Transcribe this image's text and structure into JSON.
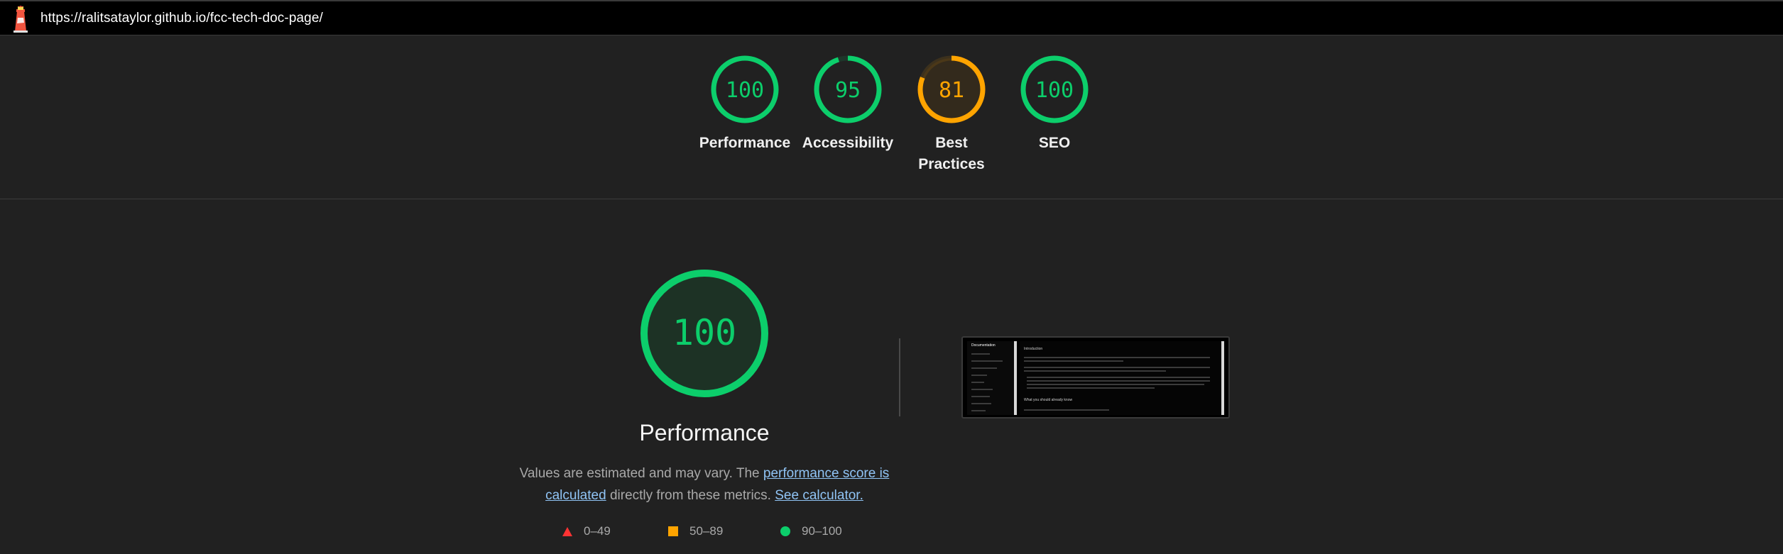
{
  "browser": {
    "url": "https://ralitsataylor.github.io/fcc-tech-doc-page/",
    "logo_icon": "lighthouse-icon"
  },
  "colors": {
    "pass": "#0cce6b",
    "average": "#ffa400",
    "fail": "#ff3333",
    "background": "#212121"
  },
  "categories": [
    {
      "label": "Performance",
      "score": "100",
      "score_value": 100,
      "status": "pass"
    },
    {
      "label": "Accessibility",
      "score": "95",
      "score_value": 95,
      "status": "pass"
    },
    {
      "label": "Best Practices",
      "score": "81",
      "score_value": 81,
      "status": "average"
    },
    {
      "label": "SEO",
      "score": "100",
      "score_value": 100,
      "status": "pass"
    }
  ],
  "performance": {
    "score": "100",
    "score_value": 100,
    "title": "Performance",
    "desc_prefix": "Values are estimated and may vary. The ",
    "desc_link": "performance score is calculated",
    "desc_middle": " directly from these metrics. ",
    "calculator_link": "See calculator."
  },
  "legend": [
    {
      "range": "0–49",
      "icon": "triangle-icon"
    },
    {
      "range": "50–89",
      "icon": "square-icon"
    },
    {
      "range": "90–100",
      "icon": "circle-icon"
    }
  ],
  "thumbnail": {
    "side_title": "Documentation",
    "main_heading": "Introduction",
    "sub_heading": "What you should already know"
  }
}
